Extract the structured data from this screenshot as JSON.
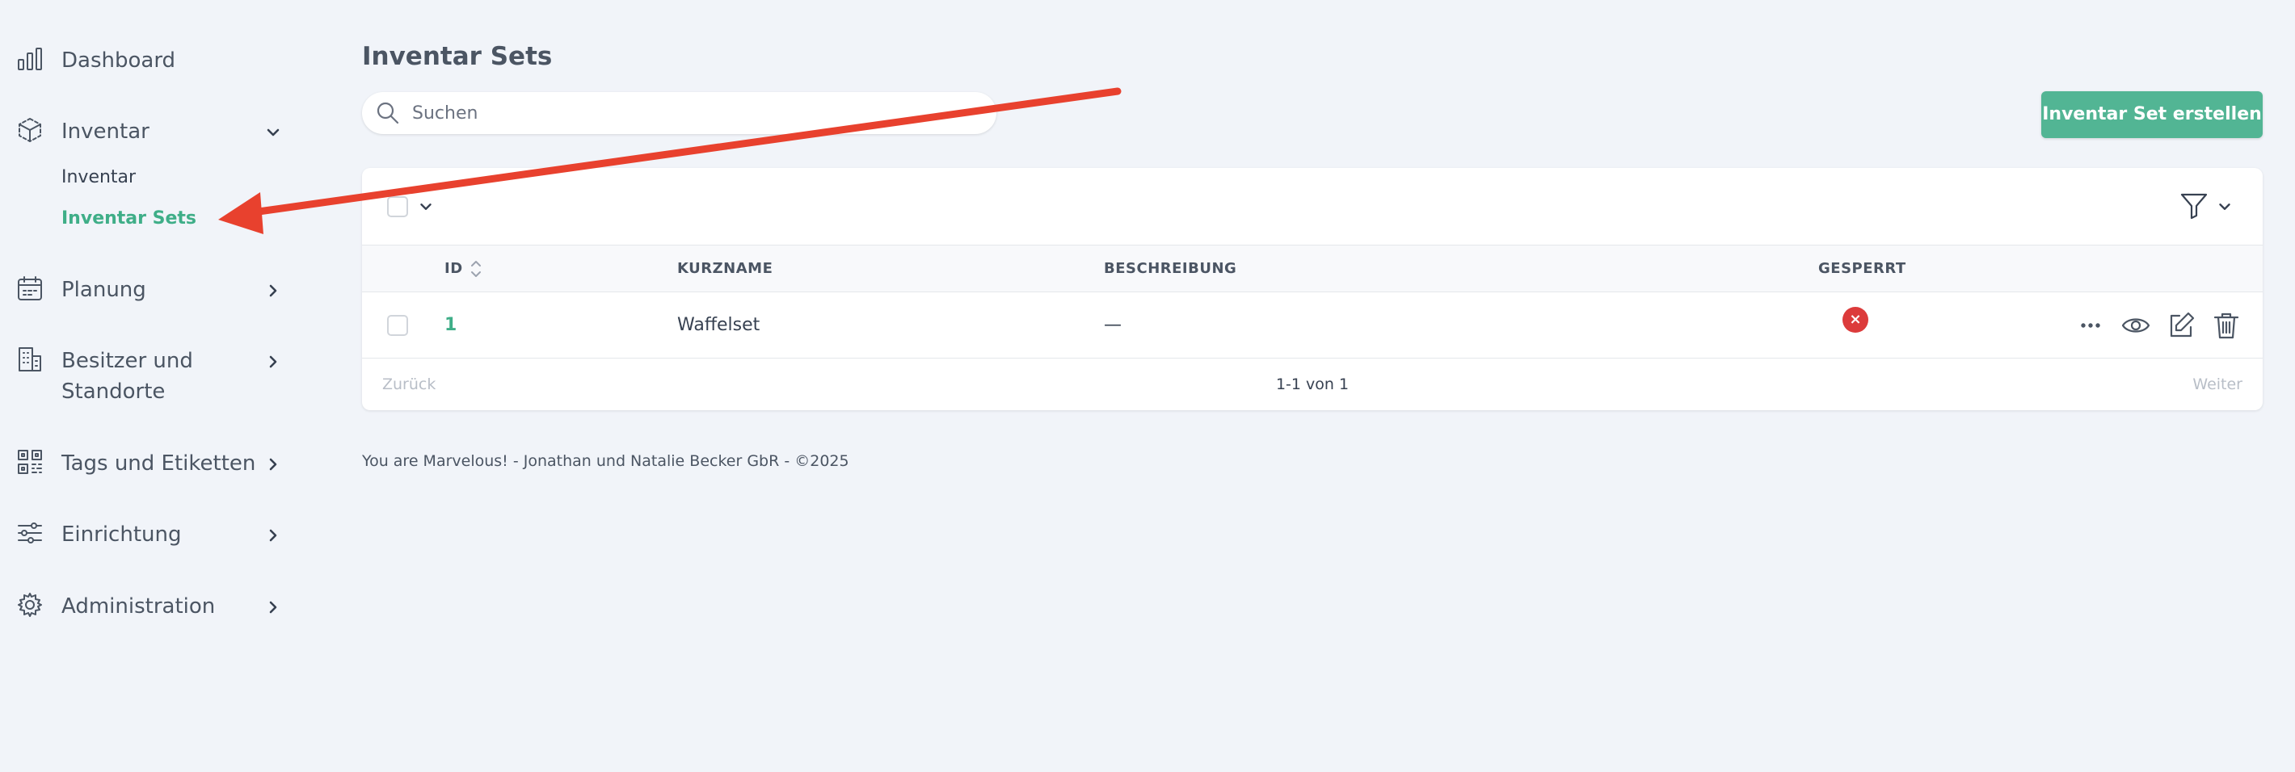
{
  "sidebar": {
    "items": [
      {
        "label": "Dashboard",
        "icon": "bar-chart-icon"
      },
      {
        "label": "Inventar",
        "icon": "cube-icon",
        "expanded": true,
        "children": [
          {
            "label": "Inventar",
            "active": false
          },
          {
            "label": "Inventar Sets",
            "active": true
          }
        ]
      },
      {
        "label": "Planung",
        "icon": "calendar-icon"
      },
      {
        "label": "Besitzer und Standorte",
        "label_line1": "Besitzer und",
        "label_line2": "Standorte",
        "icon": "building-icon"
      },
      {
        "label": "Tags und Etiketten",
        "icon": "qr-code-icon"
      },
      {
        "label": "Einrichtung",
        "icon": "sliders-icon"
      },
      {
        "label": "Administration",
        "icon": "cog-icon"
      }
    ]
  },
  "main": {
    "title": "Inventar Sets",
    "search": {
      "placeholder": "Suchen",
      "value": ""
    },
    "create_button": "Inventar Set erstellen",
    "table": {
      "columns": [
        "ID",
        "KURZNAME",
        "BESCHREIBUNG",
        "GESPERRT"
      ],
      "rows": [
        {
          "id": "1",
          "kurzname": "Waffelset",
          "beschreibung": "—",
          "gesperrt": "×"
        }
      ],
      "pagination": {
        "prev": "Zurück",
        "info": "1-1 von 1",
        "next": "Weiter"
      }
    },
    "footer": "You are Marvelous! - Jonathan und Natalie Becker GbR - ©2025"
  },
  "colors": {
    "accent": "#52b594",
    "active_text": "#3fae88",
    "danger": "#dc3b3b",
    "annotation_arrow": "#e8412e",
    "background": "#f1f4f9"
  }
}
